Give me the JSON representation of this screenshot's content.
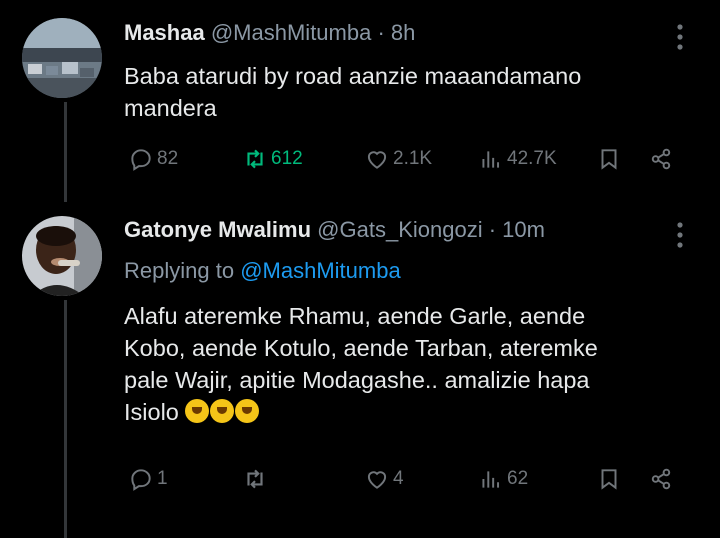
{
  "tweets": [
    {
      "name": "Mashaa",
      "handle": "@MashMitumba",
      "separator": "·",
      "time": "8h",
      "text_lines": [
        "Baba atarudi by road aanzie maaandamano",
        "mandera"
      ],
      "actions": {
        "replies": "82",
        "retweets": "612",
        "likes": "2.1K",
        "views": "42.7K"
      }
    },
    {
      "name": "Gatonye Mwalimu",
      "handle": "@Gats_Kiongozi",
      "separator": "·",
      "time": "10m",
      "replying_prefix": "Replying to",
      "replying_to": "@MashMitumba",
      "text_lines": [
        "Alafu ateremke Rhamu, aende Garle, aende",
        "Kobo, aende Kotulo, aende Tarban, ateremke",
        "pale Wajir, apitie Modagashe.. amalizie hapa",
        "Isiolo"
      ],
      "emojis": [
        "rolling-on-floor-laughing",
        "rolling-on-floor-laughing",
        "rolling-on-floor-laughing"
      ],
      "actions": {
        "replies": "1",
        "retweets": "",
        "likes": "4",
        "views": "62"
      }
    }
  ],
  "colors": {
    "background": "#000000",
    "text": "#e7e9ea",
    "muted": "#71767b",
    "link": "#1d9bf0",
    "retweet_active": "#00ba7c"
  }
}
